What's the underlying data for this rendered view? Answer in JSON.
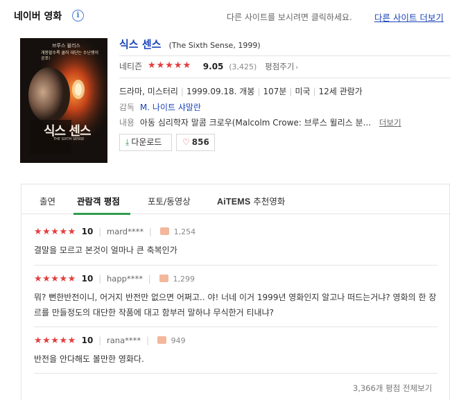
{
  "header": {
    "brand": "네이버 영화",
    "info_glyph": "i",
    "hint": "다른 사이트를 보시려면 클릭하세요.",
    "other_sites_link": "다른 사이트 더보기"
  },
  "movie": {
    "title": "식스 센스",
    "title_en": "(The Sixth Sense, 1999)",
    "poster": {
      "top_actor": "브루스 윌리스",
      "tagline": "개봉할수록 쿨러 대단는 수난쟁이 공포!",
      "title": "식스 센스",
      "subtitle": "THE SIXTH SENSE"
    },
    "rating": {
      "label": "네티즌",
      "score": "9.05",
      "score_value": 9.05,
      "max_score": 10,
      "count": "(3,425)",
      "rate_link": "평점주기"
    },
    "meta": [
      "드라마, 미스터리",
      "1999.09.18. 개봉",
      "107분",
      "미국",
      "12세 관람가"
    ],
    "director": {
      "label": "감독",
      "name": "M. 나이트 샤말란"
    },
    "content": {
      "label": "내용",
      "text": "아동 심리학자 말콤 크로우(Malcolm Crowe: 브루스 윌리스 분...",
      "more": "더보기"
    },
    "buttons": {
      "download": "다운로드",
      "likes": "856"
    }
  },
  "tabs": [
    {
      "label": "출연",
      "active": false
    },
    {
      "label": "관람객 평점",
      "active": true
    },
    {
      "label": "포토/동영상",
      "active": false
    },
    {
      "label_prefix": "AiTEMS",
      "label": " 추천영화",
      "active": false
    }
  ],
  "reviews": [
    {
      "stars": "★★★★★",
      "score": "10",
      "user": "mard****",
      "likes": "1,254",
      "text": "결말을 모르고 본것이 얼마나 큰 축복인가"
    },
    {
      "stars": "★★★★★",
      "score": "10",
      "user": "happ****",
      "likes": "1,299",
      "text": "뭐? 뻔한반전이니, 어거지 반전만 없으면 어쩌고.. 야! 너네 이거 1999년 영화인지 알고나 떠드는거냐? 영화의 한 장르를 만들정도의 대단한 작품에 대고 함부러 말하냐 무식한거 티내냐?"
    },
    {
      "stars": "★★★★★",
      "score": "10",
      "user": "rana****",
      "likes": "949",
      "text": "반전을 안다해도 볼만한 영화다."
    }
  ],
  "all_reviews_link": "3,366개 평점 전체보기",
  "colors": {
    "link_blue": "#1a44b8",
    "star_red": "#e43e3e",
    "tab_green": "#2e9e4a",
    "info_blue": "#4a7bd6"
  }
}
